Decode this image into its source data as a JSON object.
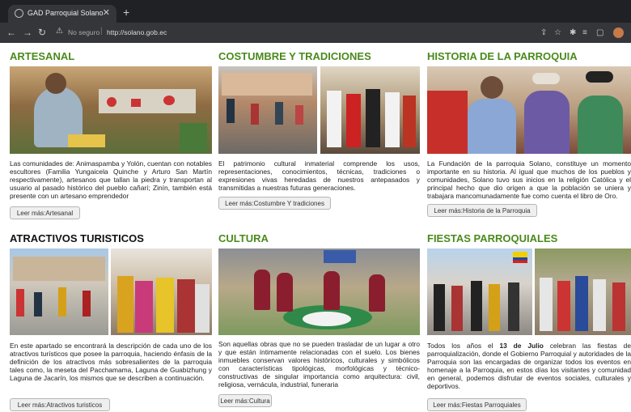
{
  "browser": {
    "tab_title": "GAD Parroquial Solano",
    "close_glyph": "✕",
    "new_tab_glyph": "+",
    "security_label": "No seguro",
    "url": "http://solano.gob.ec"
  },
  "sections": [
    {
      "title": "ARTESANAL",
      "description": "Las comunidades de: Animaspamba y Yolón, cuentan con notables escultores (Familia Yungaicela Quinche y Arturo San Martín respectivamente), artesanos que tallan la piedra y transportan al usuario al pasado histórico del pueblo cañarí; Zinín, también está presente con un artesano emprendedor",
      "button": "Leer más:Artesanal"
    },
    {
      "title": "COSTUMBRE Y TRADICIONES",
      "description": "El patrimonio cultural inmaterial comprende los usos, representaciones, conocimientos, técnicas, tradiciones o expresiones vivas heredadas de nuestros antepasados y transmitidas a nuestras futuras generaciones.",
      "button": "Leer más:Costumbre Y tradiciones"
    },
    {
      "title": "HISTORIA DE LA PARROQUIA",
      "description": "La Fundación de la parroquia Solano, constituye un momento importante en su historia. Al igual que muchos de los pueblos y comunidades, Solano tuvo sus inicios en la religión Católica y el principal hecho que dio origen a que la población se uniera y trabajara mancomunadamente fue como cuenta el libro de Oro.",
      "button": "Leer más:Historia de la Parroquia"
    },
    {
      "title": "ATRACTIVOS TURISTICOS",
      "description": "En este apartado se encontrará la descripción de cada uno de los atractivos turísticos que posee la parroquia, haciendo énfasis de la definición de los atractivos más sobresalientes de la parroquia tales como, la meseta del Pacchamama, Laguna de Guabizhung y Laguna de Jacarín, los mismos que se describen a continuación.",
      "button": "Leer más:Atractivos turisticos"
    },
    {
      "title": "CULTURA",
      "description": "Son aquellas obras que no se pueden trasladar de un lugar a otro y que están íntimamente relacionadas con el suelo. Los bienes inmuebles conservan valores históricos, culturales y simbólicos con características tipológicas, morfológicas y técnico-constructivas de singular importancia como arquitectura: civil, religiosa, vernácula, industrial, funeraria",
      "button": "Leer más:Cultura"
    },
    {
      "title": "FIESTAS PARROQUIALES",
      "description_parts": [
        "Todos los años el ",
        "13 de Julio",
        " celebran las fiestas de parroquialización, donde el Gobierno Parroquial y autoridades de la Parroquia son las encargadas de organizar todos los eventos en homenaje a la Parroquia, en estos días los visitantes y comunidad en general, podemos disfrutar de eventos sociales, culturales y deportivos."
      ],
      "button": "Leer más:Fiestas Parroquiales"
    }
  ]
}
